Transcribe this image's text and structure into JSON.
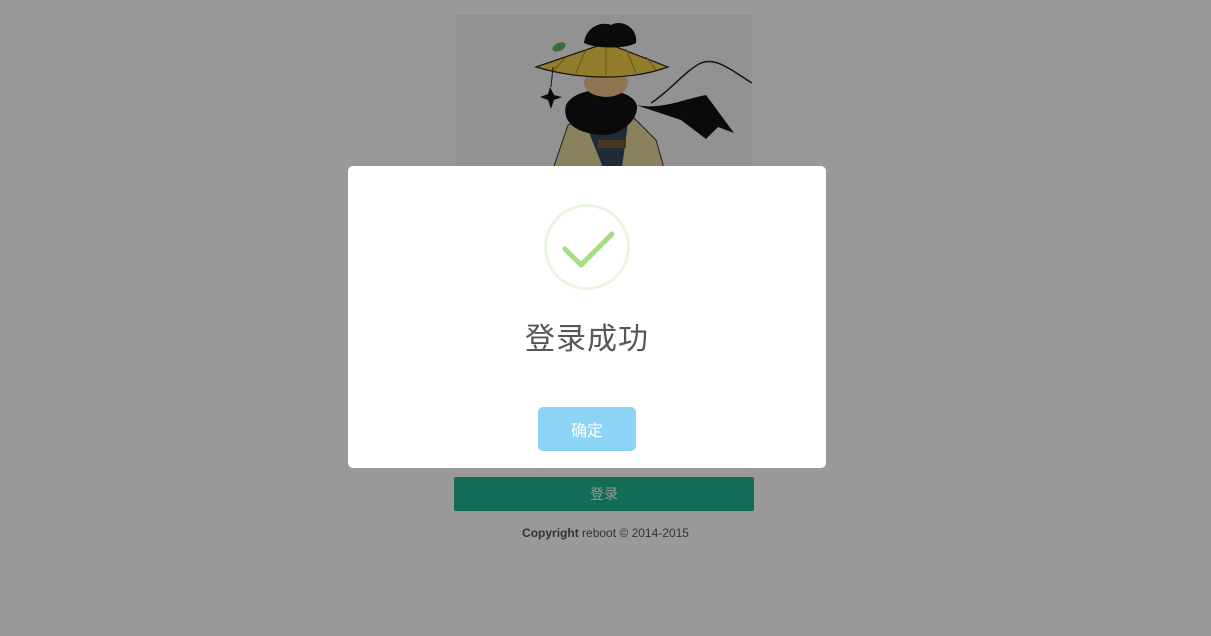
{
  "login_page": {
    "login_button_label": "登录",
    "copyright_bold": "Copyright",
    "copyright_rest": " reboot © 2014-2015"
  },
  "dialog": {
    "title": "登录成功",
    "confirm_label": "确定",
    "icon": "success-check-icon"
  },
  "colors": {
    "login_button": "#1fb58f",
    "confirm_button": "#8cd4f5",
    "success_check": "#a5dc86",
    "overlay": "rgba(0,0,0,0.4)"
  }
}
